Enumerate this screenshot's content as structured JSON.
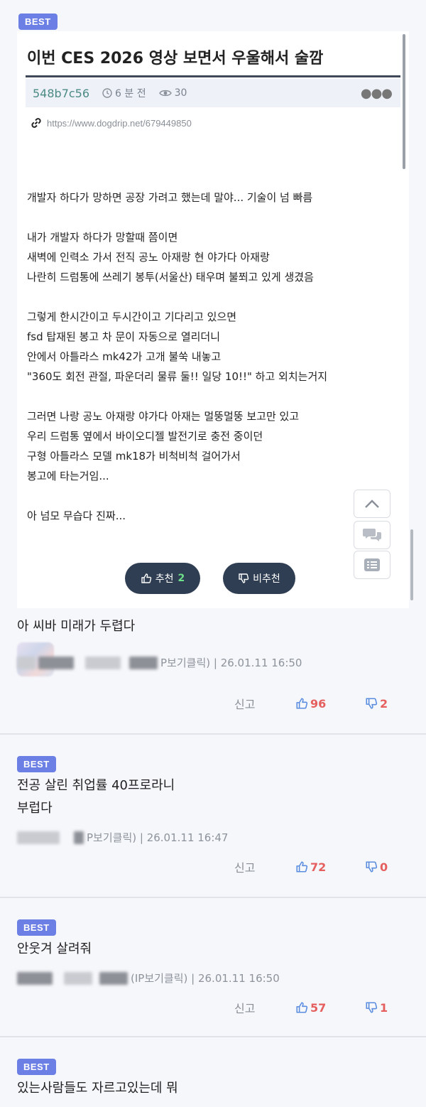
{
  "best_label": "BEST",
  "post": {
    "title": "이번 CES 2026 영상 보면서 우울해서 술깜",
    "author": "548b7c56",
    "time": "6 분 전",
    "views": "30",
    "source_url": "https://www.dogdrip.net/679449850",
    "paragraphs": [
      [
        "개발자 하다가 망하면 공장 가려고 했는데 말야... 기술이 넘 빠름"
      ],
      [
        "내가 개발자 하다가 망할때 쯤이면",
        "새벽에 인력소 가서 전직 공노 아재랑 현 야가다 아재랑",
        "나란히 드럼통에 쓰레기 봉투(서울산) 태우며 불쬐고 있게 생겼음"
      ],
      [
        "그렇게 한시간이고 두시간이고 기다리고 있으면",
        "fsd 탑재된 봉고 차 문이 자동으로 열리더니",
        "안에서 아틀라스 mk42가 고개 불쑥 내놓고",
        "\"360도 회전 관절, 파운더리 물류 둘!! 일당 10!!\" 하고 외치는거지"
      ],
      [
        "그러면 나랑 공노 아재랑 야가다 아재는 멀뚱멀뚱 보고만 있고",
        "우리 드럼통 옆에서 바이오디젤 발전기로 충전 중이던",
        "구형 아틀라스 모델 mk18가 비척비척 걸어가서",
        "봉고에 타는거임..."
      ],
      [
        "아 넘모 무습다 진짜..."
      ]
    ],
    "upvote_label": "추천",
    "upvote_count": "2",
    "downvote_label": "비추천"
  },
  "comments": [
    {
      "text": "아 씨바 미래가 두렵다",
      "meta_visible": "P보기클릭) | 26.01.11 16:50",
      "report": "신고",
      "likes": "96",
      "dislikes": "2"
    },
    {
      "badge": "BEST",
      "text_lines": [
        "전공 살린 취업률 40프로라니",
        "부럽다"
      ],
      "meta_visible": "P보기클릭) | 26.01.11 16:47",
      "report": "신고",
      "likes": "72",
      "dislikes": "0"
    },
    {
      "badge": "BEST",
      "text": "안웃겨 살려줘",
      "meta_visible": "(IP보기클릭) | 26.01.11 16:50",
      "report": "신고",
      "likes": "57",
      "dislikes": "1"
    },
    {
      "badge": "BEST",
      "text": "있는사람들도 자르고있는데 뭐"
    }
  ],
  "colors": {
    "badge": "#6b7fe4",
    "vote_button": "#2f3e52",
    "upvote_count": "#6ee08a",
    "reaction_red": "#e65f5f",
    "author": "#4b8a84"
  }
}
